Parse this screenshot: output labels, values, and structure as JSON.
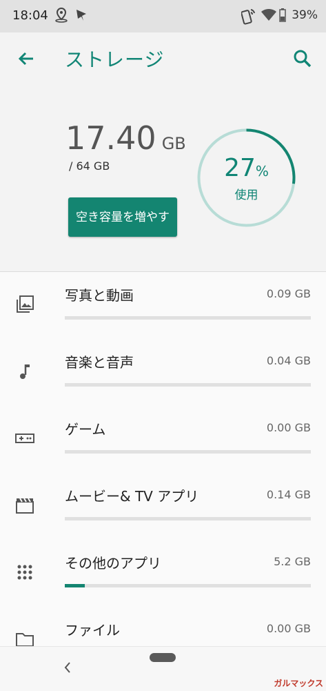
{
  "status_bar": {
    "time": "18:04",
    "battery": "39%"
  },
  "appbar": {
    "title": "ストレージ"
  },
  "summary": {
    "used_value": "17.40",
    "used_unit": "GB",
    "total": "/ 64 GB",
    "percent": "27",
    "percent_sign": "%",
    "percent_label": "使用",
    "percent_used": 27,
    "free_button_label": "空き容量を増やす"
  },
  "categories": [
    {
      "label": "写真と動画",
      "size": "0.09 GB",
      "icon": "photo-library-icon",
      "fraction": 0.0
    },
    {
      "label": "音楽と音声",
      "size": "0.04 GB",
      "icon": "music-note-icon",
      "fraction": 0.0
    },
    {
      "label": "ゲーム",
      "size": "0.00 GB",
      "icon": "gamepad-icon",
      "fraction": 0.0
    },
    {
      "label": "ムービー& TV アプリ",
      "size": "0.14 GB",
      "icon": "movie-clapper-icon",
      "fraction": 0.0
    },
    {
      "label": "その他のアプリ",
      "size": "5.2 GB",
      "icon": "apps-grid-icon",
      "fraction": 0.08
    },
    {
      "label": "ファイル",
      "size": "0.00 GB",
      "icon": "folder-icon",
      "fraction": 0.0
    }
  ],
  "watermark": "ガルマックス",
  "colors": {
    "accent": "#148571",
    "ring_track": "#b7dcd6"
  }
}
